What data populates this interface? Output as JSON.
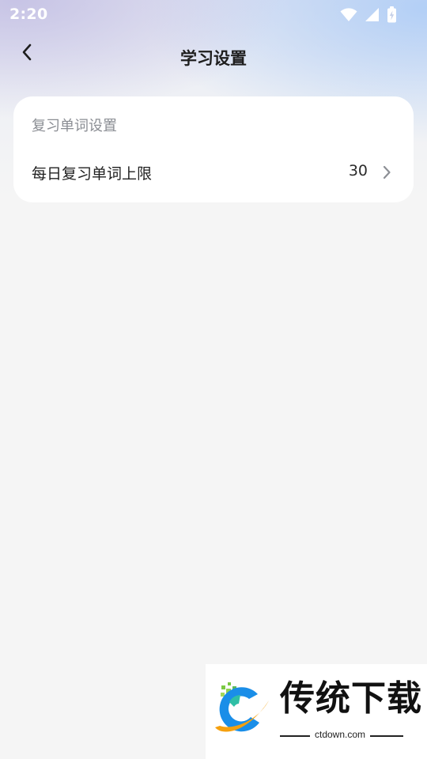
{
  "status_bar": {
    "time": "2:20",
    "icons": [
      "wifi-icon",
      "cellular-signal-icon",
      "battery-charging-icon"
    ]
  },
  "header": {
    "title": "学习设置",
    "back_icon": "chevron-left-icon"
  },
  "settings": {
    "section_title": "复习单词设置",
    "items": [
      {
        "label": "每日复习单词上限",
        "value": "30",
        "icon": "chevron-right-icon"
      }
    ]
  },
  "watermark": {
    "brand": "传统下载",
    "url": "ctdown.com"
  },
  "colors": {
    "background": "#f5f5f5",
    "card": "#ffffff",
    "section_title": "#8a8d93",
    "text": "#1f1f1f",
    "gradient_left": "#c4c0e4",
    "gradient_right": "#b0cef6",
    "logo_blue": "#1a8ee8",
    "logo_orange": "#f5a00f",
    "logo_green": "#7ac943"
  }
}
